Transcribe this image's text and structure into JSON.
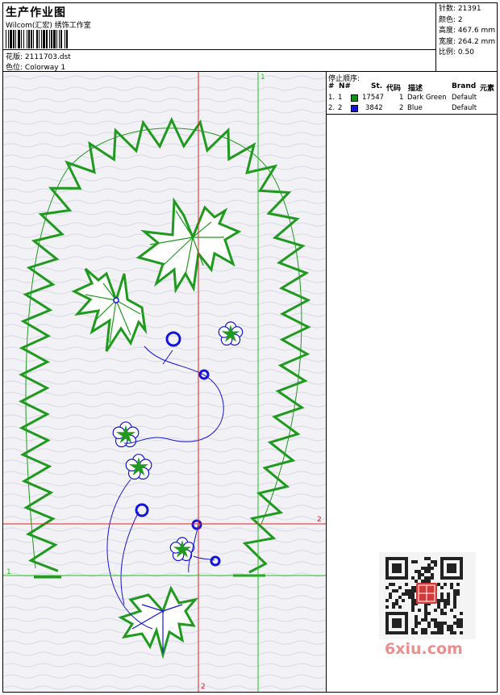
{
  "header": {
    "title": "生产作业图",
    "company": "Wilcom(汇宏) 绣饰工作室",
    "file_label": "花版:",
    "file_value": "2111703.dst",
    "color_label": "色位:",
    "color_value": "Colorway 1"
  },
  "stats": {
    "stitches_label": "针数:",
    "stitches_value": "21391",
    "colors_label": "颜色:",
    "colors_value": "2",
    "height_label": "高度:",
    "height_value": "467.6 mm",
    "width_label": "宽度:",
    "width_value": "264.2 mm",
    "scale_label": "比例:",
    "scale_value": "0.50"
  },
  "stop_sequence": {
    "title": "停止顺序:",
    "columns": [
      "#",
      "N#",
      "St.",
      "代码",
      "描述",
      "Brand",
      "元素"
    ],
    "rows": [
      {
        "index": "1.",
        "needle": "1",
        "swatch": "#1a8a1a",
        "stitches": "17547",
        "code": "1",
        "description": "Dark Green",
        "brand": "Default"
      },
      {
        "index": "2.",
        "needle": "2",
        "swatch": "#1414d8",
        "stitches": "3842",
        "code": "2",
        "description": "Blue",
        "brand": "Default"
      }
    ]
  },
  "axis_labels": {
    "v1": "1",
    "h1": "1",
    "v2": "2",
    "h2": "2"
  },
  "colors": {
    "green": "#1f9a1f",
    "blue": "#1414d8",
    "red_guide": "#e02020",
    "green_guide": "#22c322"
  },
  "watermark": "6xiu.com",
  "watermark_icons": [
    "qr-code-icon",
    "seal-stamp-icon"
  ]
}
